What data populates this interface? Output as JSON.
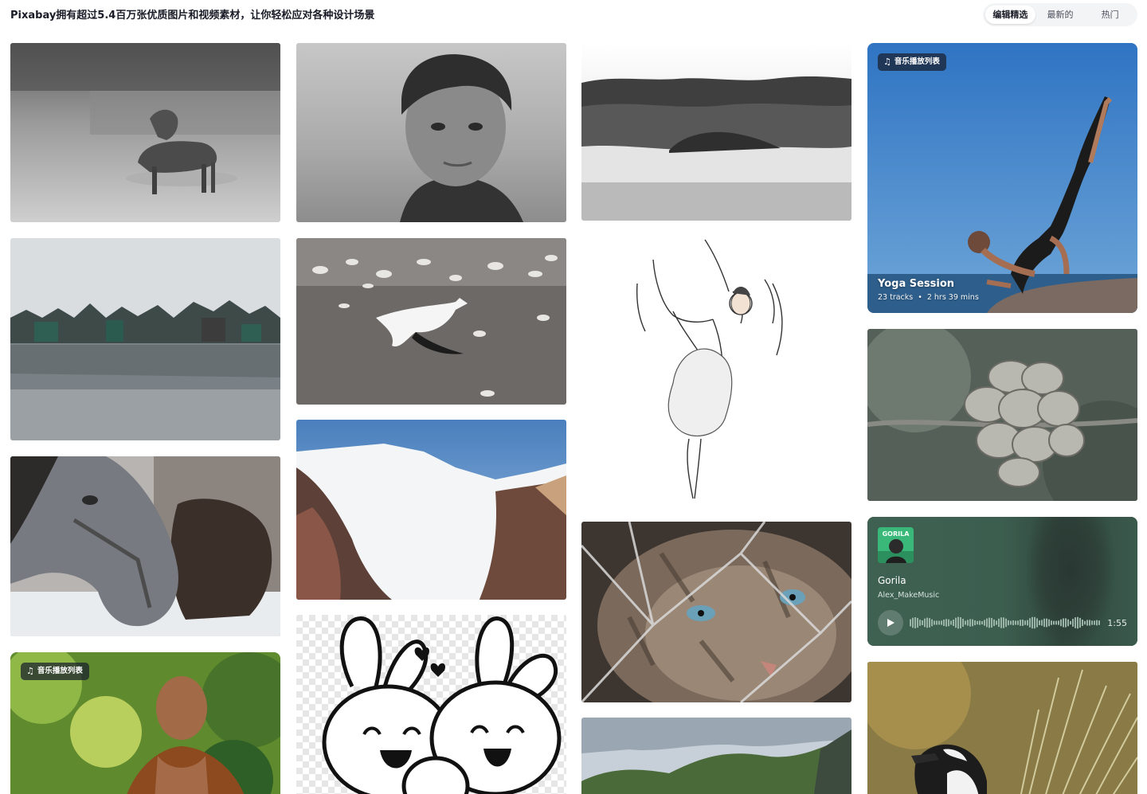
{
  "header": {
    "title": "Pixabay拥有超过5.4百万张优质图片和视频素材，让你轻松应对各种设计场景",
    "tabs": [
      {
        "label": "编辑精选",
        "active": true
      },
      {
        "label": "最新的",
        "active": false
      },
      {
        "label": "热门",
        "active": false
      }
    ]
  },
  "playlist_yoga": {
    "badge": "音乐播放列表",
    "title": "Yoga Session",
    "tracks": "23 tracks",
    "separator": "•",
    "duration": "2 hrs 39 mins"
  },
  "playlist_monk": {
    "badge": "音乐播放列表"
  },
  "track": {
    "cover_text": "GORILA",
    "title": "Gorila",
    "artist": "Alex_MakeMusic",
    "duration": "1:55"
  },
  "colors": {
    "accent_text": "#191b26",
    "music_card": "#3b5d4e",
    "tab_bg": "#f3f4f6"
  }
}
